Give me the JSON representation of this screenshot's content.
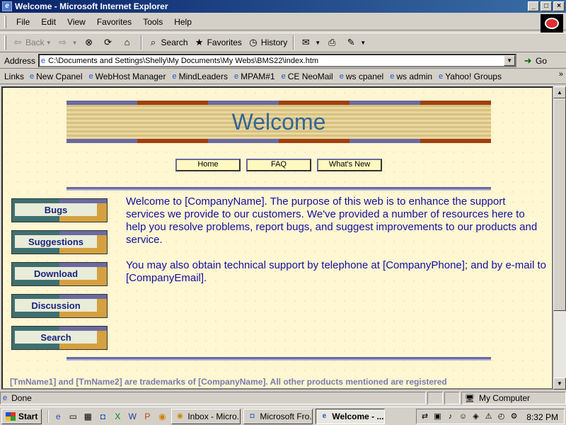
{
  "window": {
    "title": "Welcome - Microsoft Internet Explorer",
    "app_icon": "ie-icon",
    "controls": [
      "minimize",
      "maximize",
      "close"
    ]
  },
  "menu": {
    "items": [
      "File",
      "Edit",
      "View",
      "Favorites",
      "Tools",
      "Help"
    ]
  },
  "toolbar": {
    "back_label": "Back",
    "search_label": "Search",
    "favorites_label": "Favorites",
    "history_label": "History"
  },
  "address": {
    "label": "Address",
    "url": "C:\\Documents and Settings\\Shelly\\My Documents\\My Webs\\BMS22\\index.htm",
    "go_label": "Go"
  },
  "links": {
    "label": "Links",
    "items": [
      "New Cpanel",
      "WebHost Manager",
      "MindLeaders",
      "MPAM#1",
      "CE NeoMail",
      "ws cpanel",
      "ws admin",
      "Yahoo! Groups"
    ],
    "more": "»"
  },
  "page": {
    "banner_heading": "Welcome",
    "top_nav": [
      "Home",
      "FAQ",
      "What's New"
    ],
    "side_nav": [
      "Bugs",
      "Suggestions",
      "Download",
      "Discussion",
      "Search"
    ],
    "intro_paragraph_1": "Welcome to [CompanyName]. The purpose of this web is to enhance the support services we provide to our customers. We've provided a number of resources here to help you resolve problems, report bugs, and suggest improvements to our products and service.",
    "intro_paragraph_2": "You may also obtain technical support by telephone at [CompanyPhone]; and by e-mail to [CompanyEmail].",
    "footer_text": "[TmName1] and [TmName2] are trademarks of [CompanyName]. All other products mentioned are registered",
    "colors": {
      "background": "#fff6d2",
      "heading": "#336699",
      "body_text": "#1010a0",
      "footer_text": "#7a7ab0",
      "rule": "#6a6aa0"
    }
  },
  "status": {
    "text": "Done",
    "zone": "My Computer"
  },
  "taskbar": {
    "start_label": "Start",
    "tasks": [
      {
        "label": "Inbox - Micro...",
        "active": false
      },
      {
        "label": "Microsoft Fro...",
        "active": false
      },
      {
        "label": "Welcome - ...",
        "active": true
      }
    ],
    "clock": "8:32 PM"
  }
}
